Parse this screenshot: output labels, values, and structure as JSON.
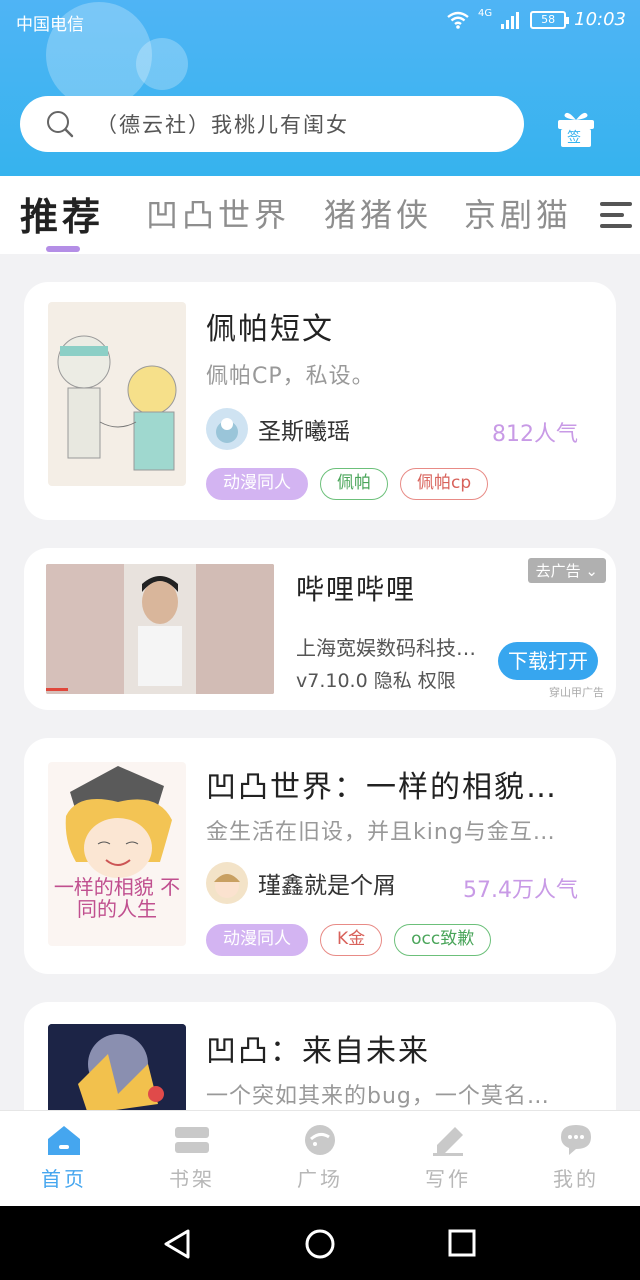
{
  "status_bar": {
    "carrier": "中国电信",
    "network": "4G",
    "battery": "58",
    "time": "10:03"
  },
  "search": {
    "placeholder": "（德云社）我桃儿有闺女",
    "gift_label": "签"
  },
  "tabs": [
    {
      "label": "推荐",
      "active": true
    },
    {
      "label": "凹凸世界",
      "active": false
    },
    {
      "label": "猪猪侠",
      "active": false
    },
    {
      "label": "京剧猫",
      "active": false
    }
  ],
  "cards": [
    {
      "title": "佩帕短文",
      "desc": "佩帕CP，私设。",
      "author": "圣斯曦瑶",
      "popularity": "812人气",
      "tags": [
        {
          "label": "动漫同人",
          "style": "purple"
        },
        {
          "label": "佩帕",
          "style": "green"
        },
        {
          "label": "佩帕cp",
          "style": "red"
        }
      ]
    },
    {
      "title": "凹凸世界：一样的相貌…",
      "desc": "金生活在旧设，并且king与金互…",
      "author": "瑾鑫就是个屑",
      "popularity": "57.4万人气",
      "cover_text": "一样的相貌 不同的人生",
      "tags": [
        {
          "label": "动漫同人",
          "style": "purple"
        },
        {
          "label": "K金",
          "style": "red"
        },
        {
          "label": "occ致歉",
          "style": "green"
        }
      ]
    },
    {
      "title": "凹凸：来自未来",
      "desc": "一个突如其来的bug，一个莫名…"
    }
  ],
  "ad": {
    "title": "哔哩哔哩",
    "company": "上海宽娱数码科技有限公司",
    "meta": "v7.10.0 隐私 权限",
    "remove_label": "去广告",
    "download_label": "下载打开",
    "source": "穿山甲广告"
  },
  "bottom_nav": [
    {
      "label": "首页",
      "icon": "home-icon",
      "active": true
    },
    {
      "label": "书架",
      "icon": "bookshelf-icon",
      "active": false
    },
    {
      "label": "广场",
      "icon": "plaza-icon",
      "active": false
    },
    {
      "label": "写作",
      "icon": "write-icon",
      "active": false
    },
    {
      "label": "我的",
      "icon": "profile-icon",
      "active": false
    }
  ],
  "colors": {
    "header": "#4fb4f5",
    "accent": "#45a6ef",
    "tag_purple": "#d3b4f2",
    "popularity": "#c89ae6"
  }
}
